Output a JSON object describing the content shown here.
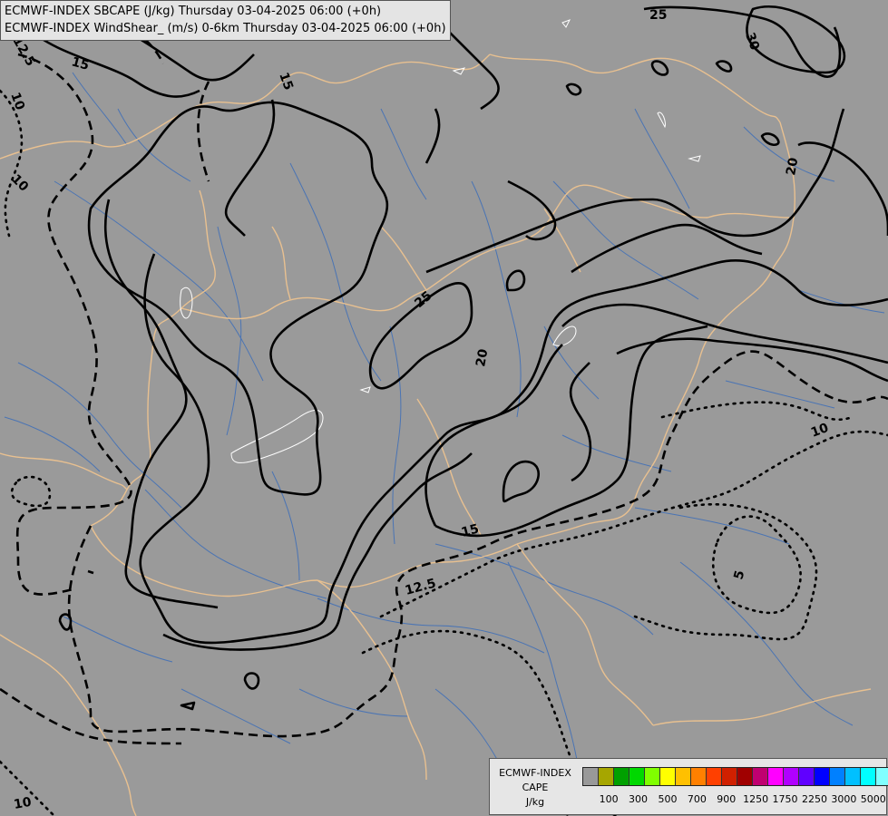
{
  "header": {
    "line1": "ECMWF-INDEX SBCAPE (J/kg) Thursday 03-04-2025 06:00 (+0h)",
    "line2": "ECMWF-INDEX WindShear_ (m/s) 0-6km Thursday 03-04-2025 06:00 (+0h)"
  },
  "contour_labels": [
    "25",
    "30",
    "20",
    "25",
    "20",
    "15",
    "12.5",
    "10",
    "5",
    "15",
    "15",
    "12.5",
    "10",
    "10",
    "10",
    "5"
  ],
  "legend": {
    "title_line1": "ECMWF-INDEX",
    "title_line2": "CAPE",
    "unit": "J/kg",
    "colors": [
      "#999999",
      "#a6a600",
      "#00a000",
      "#00d800",
      "#80ff00",
      "#ffff00",
      "#ffc000",
      "#ff8000",
      "#ff4000",
      "#d02000",
      "#a00000",
      "#c00070",
      "#ff00ff",
      "#b000ff",
      "#6000ff",
      "#0000ff",
      "#0080ff",
      "#00c0ff",
      "#00ffff",
      "#80ffff",
      "#ffffff"
    ],
    "ticks": [
      "100",
      "300",
      "500",
      "700",
      "900",
      "1250",
      "1750",
      "2250",
      "3000",
      "5000"
    ]
  },
  "colors": {
    "background": "#9a9a9a",
    "borders": "#e8c090",
    "rivers": "#4a74b4",
    "contours": "#000000"
  }
}
